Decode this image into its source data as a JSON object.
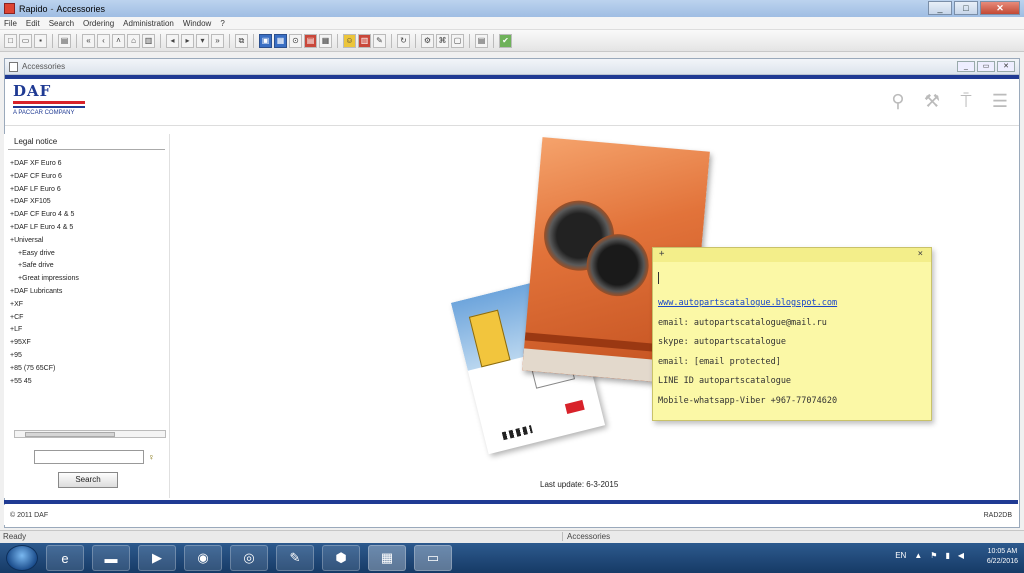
{
  "window": {
    "title": "Rapido",
    "subtitle": "Accessories"
  },
  "menu": [
    "File",
    "Edit",
    "Search",
    "Ordering",
    "Administration",
    "Window",
    "?"
  ],
  "inner_window": {
    "title": "Accessories"
  },
  "brand": {
    "logo_text": "DAF",
    "tagline": "A PACCAR COMPANY"
  },
  "left_panel": {
    "legal_notice": "Legal notice",
    "tree": [
      {
        "label": "DAF XF Euro 6",
        "level": 0
      },
      {
        "label": "DAF CF Euro 6",
        "level": 0
      },
      {
        "label": "DAF LF Euro 6",
        "level": 0
      },
      {
        "label": "DAF XF105",
        "level": 0
      },
      {
        "label": "DAF CF Euro 4 & 5",
        "level": 0
      },
      {
        "label": "DAF LF Euro 4 & 5",
        "level": 0
      },
      {
        "label": "Universal",
        "level": 0
      },
      {
        "label": "Easy drive",
        "level": 1
      },
      {
        "label": "Safe drive",
        "level": 1
      },
      {
        "label": "Great impressions",
        "level": 1
      },
      {
        "label": "DAF Lubricants",
        "level": 0
      },
      {
        "label": "XF",
        "level": 0
      },
      {
        "label": "CF",
        "level": 0
      },
      {
        "label": "LF",
        "level": 0
      },
      {
        "label": "95XF",
        "level": 0
      },
      {
        "label": "95",
        "level": 0
      },
      {
        "label": "85 (75 65CF)",
        "level": 0
      },
      {
        "label": "55 45",
        "level": 0
      }
    ],
    "search": {
      "value": "",
      "button_label": "Search"
    }
  },
  "main": {
    "last_update": "Last update: 6-3-2015"
  },
  "sticky_note": {
    "lines": [
      "www.autopartscatalogue.blogspot.com",
      "email: autopartscatalogue@mail.ru",
      "skype: autopartscatalogue",
      "email: [email protected]",
      "LINE ID autopartscatalogue",
      "Mobile-whatsapp-Viber +967-77074620"
    ]
  },
  "footer": {
    "left": "© 2011 DAF",
    "right": "RAD2DB"
  },
  "status": {
    "left": "Ready",
    "right": "Accessories"
  },
  "taskbar": {
    "apps": [
      "start-icon",
      "ie-icon",
      "explorer-icon",
      "media-icon",
      "firefox-icon",
      "chrome-icon",
      "app-icon",
      "vm-icon",
      "rapido-icon",
      "sticky-icon"
    ],
    "tray_lang": "EN",
    "time": "10:05 AM",
    "date": "6/22/2016"
  },
  "colors": {
    "daf_blue": "#1f3a93",
    "daf_red": "#d8222a",
    "sticky": "#fbf8a6"
  }
}
